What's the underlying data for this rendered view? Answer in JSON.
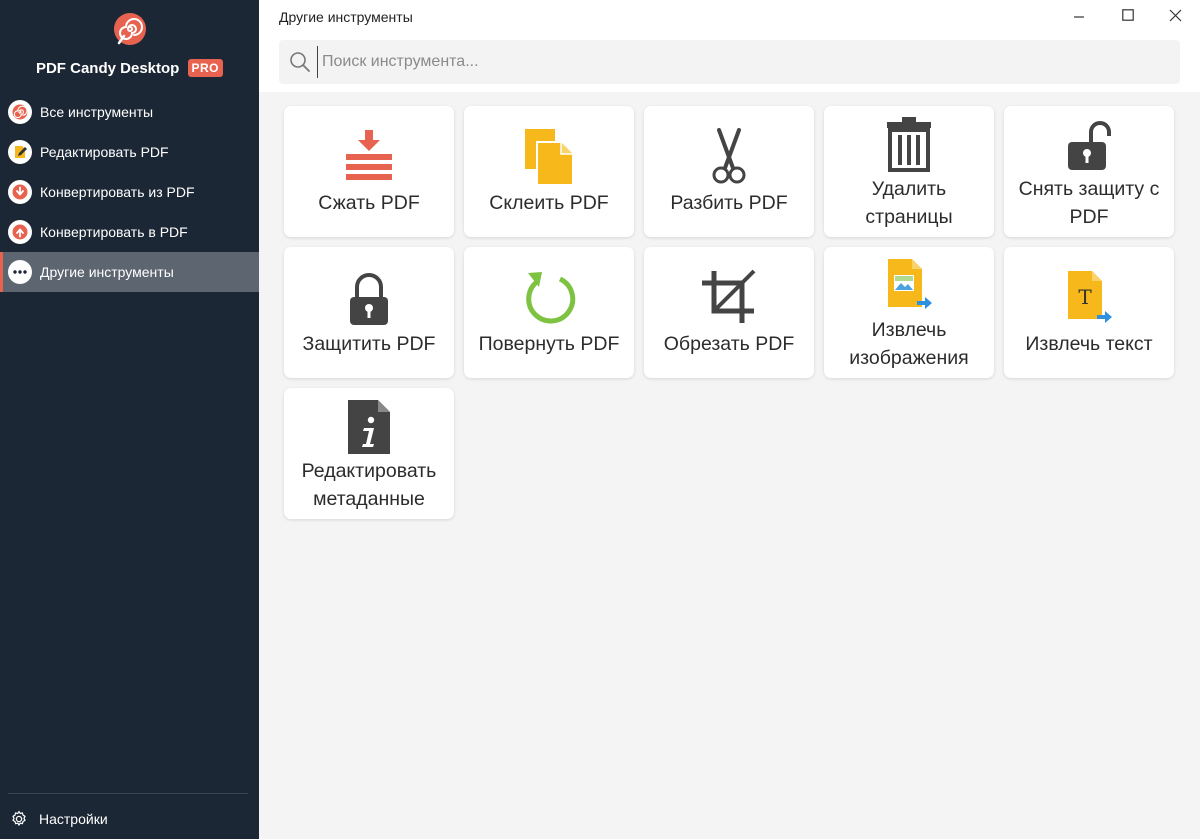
{
  "app": {
    "name": "PDF Candy Desktop",
    "badge": "PRO",
    "accent_color": "#e8634f",
    "sidebar_color": "#1c2735"
  },
  "sidebar": {
    "items": [
      {
        "label": "Все инструменты",
        "icon": "spiral-icon",
        "active": false
      },
      {
        "label": "Редактировать PDF",
        "icon": "pencil-icon",
        "active": false
      },
      {
        "label": "Конвертировать из PDF",
        "icon": "arrow-down-icon",
        "active": false
      },
      {
        "label": "Конвертировать в PDF",
        "icon": "arrow-up-icon",
        "active": false
      },
      {
        "label": "Другие инструменты",
        "icon": "ellipsis-icon",
        "active": true
      }
    ],
    "settings_label": "Настройки"
  },
  "header": {
    "title": "Другие инструменты",
    "window_controls": [
      "minimize-icon",
      "maximize-icon",
      "close-icon"
    ]
  },
  "search": {
    "placeholder": "Поиск инструмента...",
    "value": ""
  },
  "tools": [
    {
      "label": "Сжать PDF",
      "icon": "compress-icon"
    },
    {
      "label": "Склеить PDF",
      "icon": "merge-icon"
    },
    {
      "label": "Разбить PDF",
      "icon": "scissors-icon"
    },
    {
      "label": "Удалить страницы",
      "icon": "trash-icon"
    },
    {
      "label": "Снять защиту с PDF",
      "icon": "unlock-icon"
    },
    {
      "label": "Защитить PDF",
      "icon": "lock-icon"
    },
    {
      "label": "Повернуть PDF",
      "icon": "rotate-icon"
    },
    {
      "label": "Обрезать PDF",
      "icon": "crop-icon"
    },
    {
      "label": "Извлечь изображения",
      "icon": "extract-images-icon"
    },
    {
      "label": "Извлечь текст",
      "icon": "extract-text-icon"
    },
    {
      "label": "Редактировать метаданные",
      "icon": "metadata-icon"
    }
  ]
}
